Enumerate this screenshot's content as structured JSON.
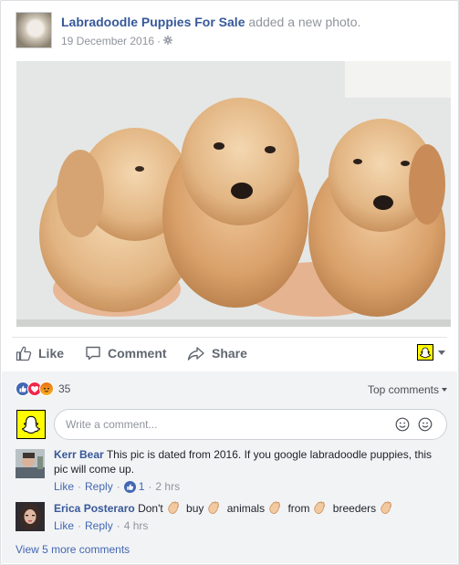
{
  "post": {
    "page_name": "Labradoodle Puppies For Sale",
    "action_text": " added a new photo.",
    "date": "19 December 2016",
    "separator": "·",
    "audience_icon": "gear-icon"
  },
  "actions": {
    "like_label": "Like",
    "comment_label": "Comment",
    "share_label": "Share"
  },
  "reactions": {
    "types": [
      "like",
      "love",
      "angry"
    ],
    "count": "35"
  },
  "comments_header": {
    "sort_label": "Top comments"
  },
  "composer": {
    "placeholder": "Write a comment..."
  },
  "comments": [
    {
      "author": "Kerr Bear",
      "text": "This pic is dated from 2016. If you google labradoodle puppies, this pic will come up.",
      "like_label": "Like",
      "reply_label": "Reply",
      "like_count": "1",
      "time": "2 hrs"
    },
    {
      "author": "Erica Posteraro",
      "words": [
        "Don't",
        "buy",
        "animals",
        "from",
        "breeders"
      ],
      "like_label": "Like",
      "reply_label": "Reply",
      "time": "4 hrs"
    }
  ],
  "view_more": "View 5 more comments",
  "colors": {
    "link_blue": "#365899",
    "action_grey": "#616770",
    "meta_grey": "#90949c",
    "like_blue": "#4267b2",
    "snap_yellow": "#fffc00"
  }
}
